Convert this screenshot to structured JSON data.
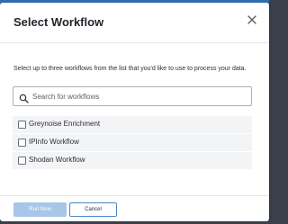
{
  "dialog": {
    "title": "Select Workflow",
    "close_icon": "close-icon",
    "instruction": "Select up to three workflows from the list that you'd like to use to process your data.",
    "search": {
      "icon": "search-icon",
      "placeholder": "Search for workflows",
      "value": ""
    },
    "workflows": [
      {
        "label": "Greynoise Enrichment",
        "checked": false
      },
      {
        "label": "IPInfo Workflow",
        "checked": false
      },
      {
        "label": "Shodan Workflow",
        "checked": false
      }
    ],
    "footer": {
      "run_label": "Run Now",
      "run_enabled": false,
      "cancel_label": "Cancel"
    }
  },
  "colors": {
    "primary": "#4d88c9",
    "primary_disabled": "#a8c6e8",
    "row_background": "#f3f4f6",
    "text": "#2b2f36"
  }
}
